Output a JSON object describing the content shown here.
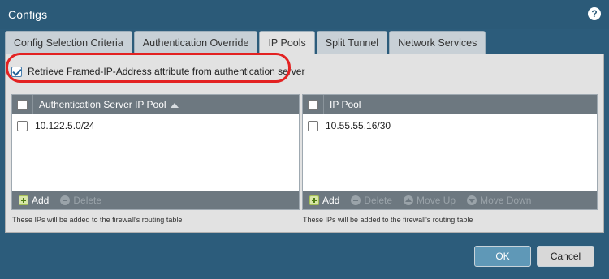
{
  "dialog": {
    "title": "Configs",
    "help_icon": "?"
  },
  "tabs": [
    {
      "label": "Config Selection Criteria",
      "active": false
    },
    {
      "label": "Authentication Override",
      "active": false
    },
    {
      "label": "IP Pools",
      "active": true
    },
    {
      "label": "Split Tunnel",
      "active": false
    },
    {
      "label": "Network Services",
      "active": false
    }
  ],
  "retrieve": {
    "label": "Retrieve Framed-IP-Address attribute from authentication server",
    "checked": true
  },
  "auth_pool_grid": {
    "header": "Authentication Server IP Pool",
    "rows": [
      "10.122.5.0/24"
    ],
    "add_label": "Add",
    "delete_label": "Delete",
    "note": "These IPs will be added to the firewall's routing table"
  },
  "ip_pool_grid": {
    "header": "IP Pool",
    "rows": [
      "10.55.55.16/30"
    ],
    "add_label": "Add",
    "delete_label": "Delete",
    "move_up_label": "Move Up",
    "move_down_label": "Move Down",
    "note": "These IPs will be added to the firewall's routing table"
  },
  "buttons": {
    "ok": "OK",
    "cancel": "Cancel"
  },
  "colors": {
    "background": "#2b5a78",
    "panel": "#e2e2e2",
    "grid_header": "#6d7880",
    "highlight": "#e32222",
    "ok_button": "#5f98b7"
  }
}
